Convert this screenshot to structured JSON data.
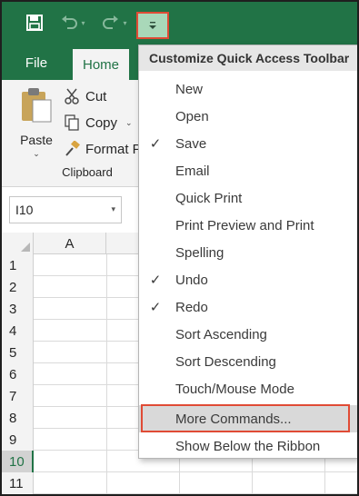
{
  "quick_access": {
    "save_icon": "save-icon",
    "undo_icon": "undo-icon",
    "redo_icon": "redo-icon",
    "customize_icon": "customize-dropdown-icon"
  },
  "tabs": [
    {
      "label": "File"
    },
    {
      "label": "Home"
    }
  ],
  "ribbon": {
    "paste_label": "Paste",
    "cut_label": "Cut",
    "copy_label": "Copy",
    "format_painter_label": "Format P",
    "group_label": "Clipboard"
  },
  "name_box": {
    "value": "I10"
  },
  "grid": {
    "column_header": "A",
    "rows": [
      "1",
      "2",
      "3",
      "4",
      "5",
      "6",
      "7",
      "8",
      "9",
      "10",
      "11"
    ],
    "active_row": "10"
  },
  "menu": {
    "title": "Customize Quick Access Toolbar",
    "items": [
      {
        "label": "New",
        "checked": false
      },
      {
        "label": "Open",
        "checked": false
      },
      {
        "label": "Save",
        "checked": true
      },
      {
        "label": "Email",
        "checked": false
      },
      {
        "label": "Quick Print",
        "checked": false
      },
      {
        "label": "Print Preview and Print",
        "checked": false
      },
      {
        "label": "Spelling",
        "checked": false
      },
      {
        "label": "Undo",
        "checked": true
      },
      {
        "label": "Redo",
        "checked": true
      },
      {
        "label": "Sort Ascending",
        "checked": false
      },
      {
        "label": "Sort Descending",
        "checked": false
      },
      {
        "label": "Touch/Mouse Mode",
        "checked": false
      },
      {
        "label": "More Commands...",
        "checked": false,
        "highlighted": true
      },
      {
        "label": "Show Below the Ribbon",
        "checked": false
      }
    ]
  },
  "colors": {
    "brand_green": "#217346",
    "highlight_red": "#e04b35",
    "menu_hover": "#d9d9d9"
  }
}
